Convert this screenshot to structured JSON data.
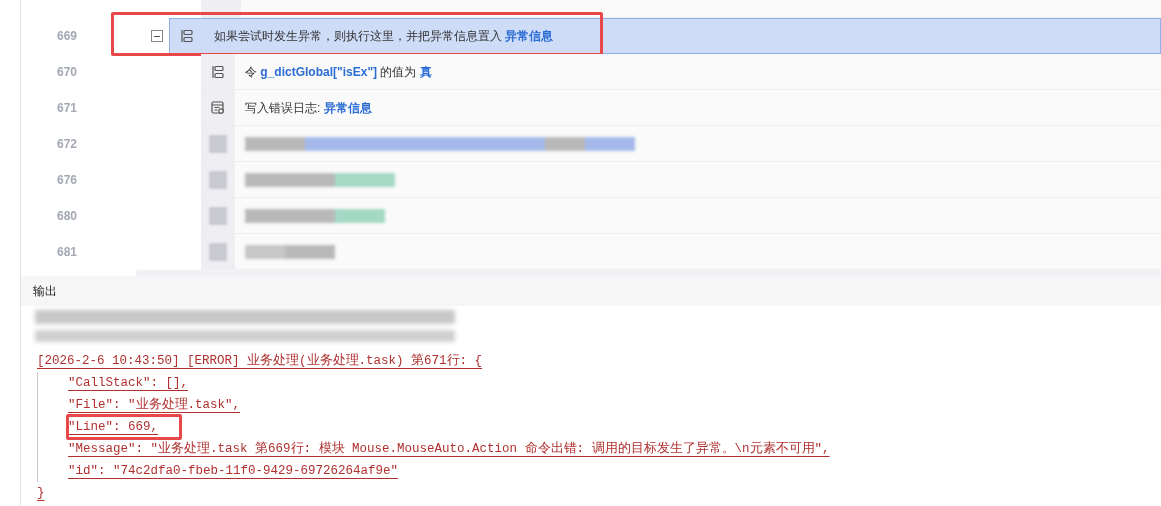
{
  "editor": {
    "rows": [
      {
        "line": "669",
        "kind": "catch",
        "selected": true,
        "expanded": true,
        "annotated": true,
        "segments": [
          {
            "kind": "text",
            "text": "如果尝试时发生异常，则执行这里，并把异常信息置入 "
          },
          {
            "kind": "variable",
            "text": "异常信息"
          }
        ]
      },
      {
        "line": "670",
        "kind": "assign",
        "selected": false,
        "annotated": false,
        "segments": [
          {
            "kind": "text",
            "text": "令 "
          },
          {
            "kind": "variable",
            "text": "g_dictGlobal[\"isEx\"]"
          },
          {
            "kind": "text",
            "text": " 的值为 "
          },
          {
            "kind": "value",
            "text": "真"
          }
        ]
      },
      {
        "line": "671",
        "kind": "log",
        "selected": false,
        "annotated": false,
        "segments": [
          {
            "kind": "text",
            "text": "写入错误日志: "
          },
          {
            "kind": "value",
            "text": "异常信息"
          }
        ]
      },
      {
        "line": "672",
        "kind": "blurred",
        "selected": false,
        "annotated": false
      },
      {
        "line": "676",
        "kind": "blurred",
        "selected": false,
        "annotated": false
      },
      {
        "line": "680",
        "kind": "blurred",
        "selected": false,
        "annotated": false
      },
      {
        "line": "681",
        "kind": "blurred",
        "selected": false,
        "annotated": false
      }
    ]
  },
  "output": {
    "title": "输出",
    "log": [
      {
        "indent": false,
        "annotated": false,
        "text": "[2026-2-6 10:43:50] [ERROR] 业务处理(业务处理.task) 第671行: {"
      },
      {
        "indent": true,
        "annotated": false,
        "text": "\"CallStack\": [],"
      },
      {
        "indent": true,
        "annotated": false,
        "text": "\"File\": \"业务处理.task\","
      },
      {
        "indent": true,
        "annotated": true,
        "text": "\"Line\": 669,"
      },
      {
        "indent": true,
        "annotated": false,
        "text": "\"Message\": \"业务处理.task 第669行: 模块 Mouse.MouseAuto.Action 命令出错: 调用的目标发生了异常。\\n元素不可用\","
      },
      {
        "indent": true,
        "annotated": false,
        "text": "\"id\": \"74c2dfa0-fbeb-11f0-9429-69726264af9e\""
      },
      {
        "indent": false,
        "annotated": false,
        "text": "}"
      }
    ]
  }
}
